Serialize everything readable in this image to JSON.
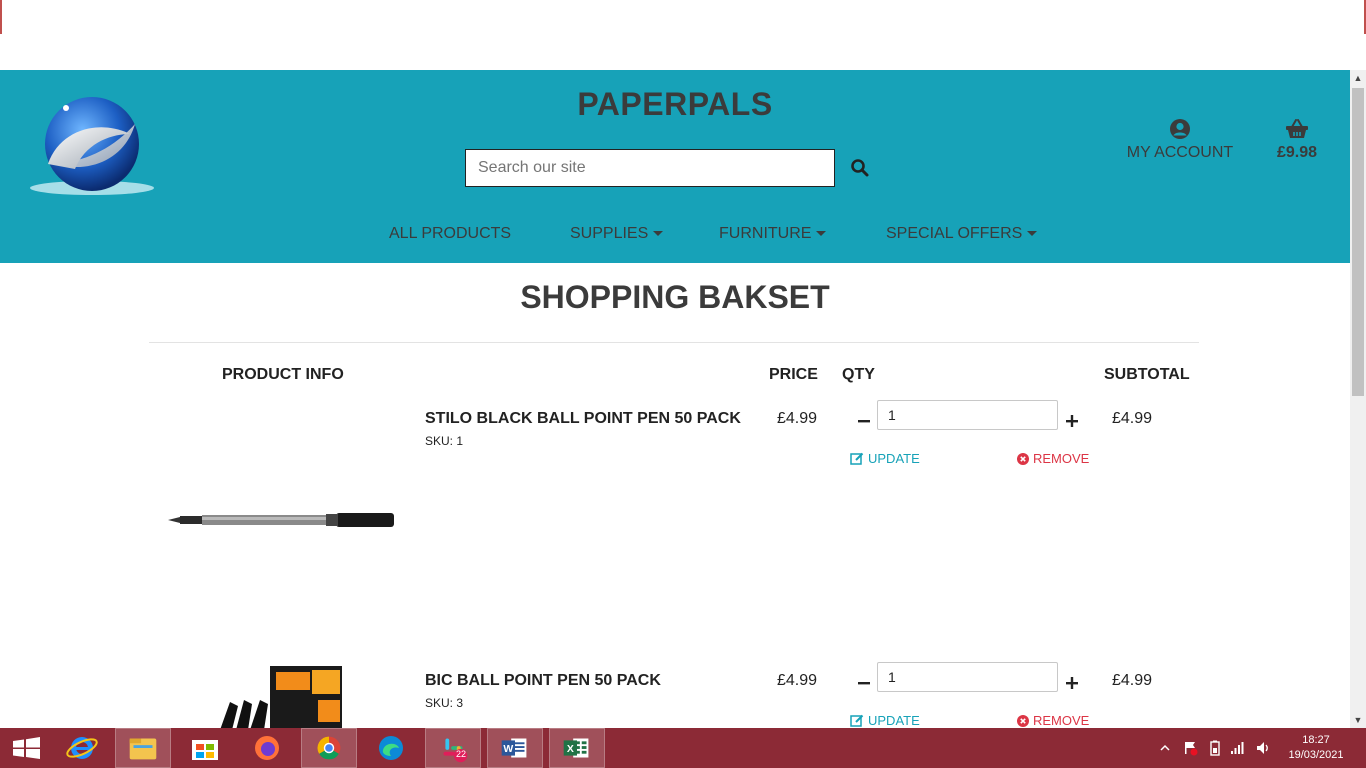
{
  "site": {
    "brand": "PAPERPALS",
    "search_placeholder": "Search our site",
    "account_label": "MY ACCOUNT",
    "basket_total": "£9.98"
  },
  "nav": {
    "items": [
      {
        "label": "ALL PRODUCTS",
        "has_dropdown": false
      },
      {
        "label": "SUPPLIES",
        "has_dropdown": true
      },
      {
        "label": "FURNITURE",
        "has_dropdown": true
      },
      {
        "label": "SPECIAL OFFERS",
        "has_dropdown": true
      }
    ]
  },
  "basket": {
    "title": "SHOPPING BAKSET",
    "headers": {
      "product_info": "PRODUCT INFO",
      "price": "PRICE",
      "qty": "QTY",
      "subtotal": "SUBTOTAL"
    },
    "update_label": "UPDATE",
    "remove_label": "REMOVE",
    "items": [
      {
        "name": "STILO BLACK BALL POINT PEN 50 PACK",
        "sku": "SKU: 1",
        "price": "£4.99",
        "qty": "1",
        "subtotal": "£4.99"
      },
      {
        "name": "BIC BALL POINT PEN 50 PACK",
        "sku": "SKU: 3",
        "price": "£4.99",
        "qty": "1",
        "subtotal": "£4.99"
      }
    ]
  },
  "taskbar": {
    "apps": [
      "start-icon",
      "internet-explorer-icon",
      "file-explorer-icon",
      "store-icon",
      "firefox-icon",
      "chrome-icon",
      "edge-icon",
      "slack-icon",
      "word-icon",
      "excel-icon"
    ],
    "slack_badge": "22",
    "time": "18:27",
    "date": "19/03/2021"
  },
  "colors": {
    "header_bg": "#17a2b8",
    "update": "#17a2b8",
    "remove": "#dc3545",
    "taskbar": "#8c2a36"
  }
}
